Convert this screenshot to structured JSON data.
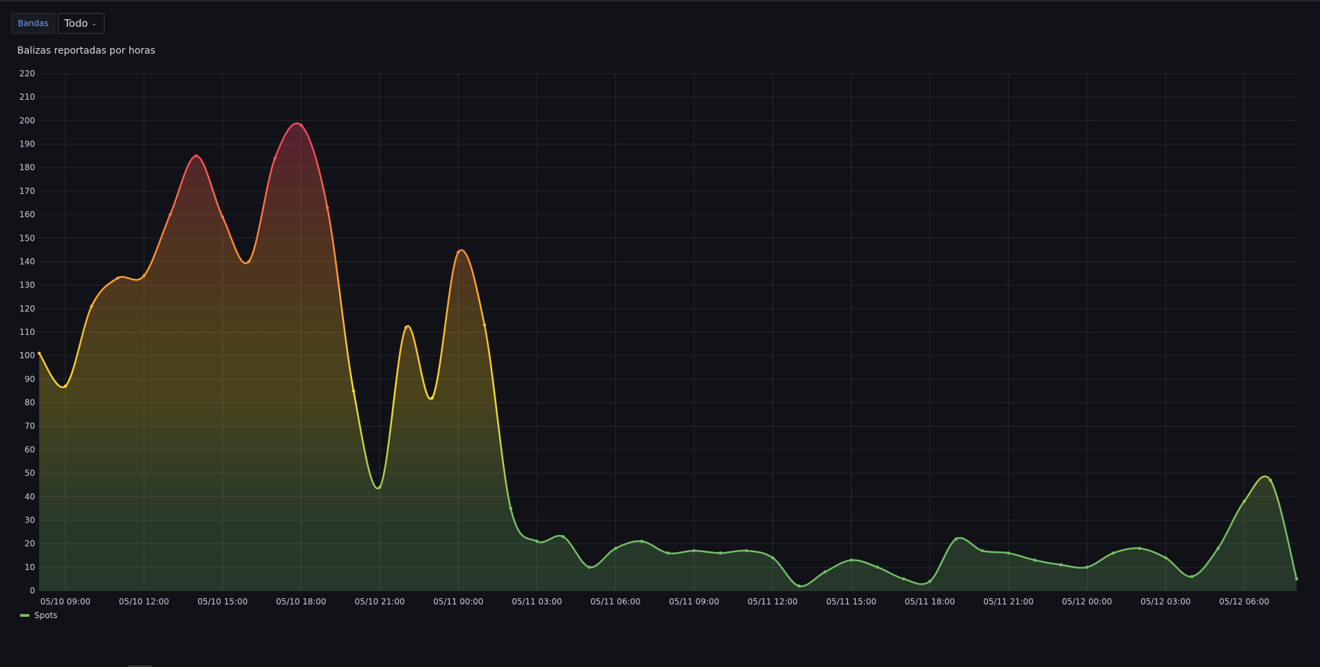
{
  "toolbar": {
    "variable_label": "Bandas",
    "variable_value": "Todo"
  },
  "panel": {
    "title": "Balizas reportadas por horas"
  },
  "colors": {
    "background": "#111217",
    "grid": "#272a31",
    "axis_text": "#ccccdc",
    "series_low": "#73bf69",
    "series_mid": "#fade2a",
    "series_mid_high": "#ff9830",
    "series_high": "#f2495c"
  },
  "legend": {
    "series_name": "Spots",
    "color": "#73bf69"
  },
  "chart_data": {
    "type": "area",
    "title": "Balizas reportadas por horas",
    "xlabel": "",
    "ylabel": "",
    "ylim": [
      0,
      220
    ],
    "ytick_step": 10,
    "x_start": "05/10 08:00",
    "x_step_hours": 1,
    "x_ticks": [
      "05/10 09:00",
      "05/10 12:00",
      "05/10 15:00",
      "05/10 18:00",
      "05/10 21:00",
      "05/11 00:00",
      "05/11 03:00",
      "05/11 06:00",
      "05/11 09:00",
      "05/11 12:00",
      "05/11 15:00",
      "05/11 18:00",
      "05/11 21:00",
      "05/12 00:00",
      "05/12 03:00",
      "05/12 06:00"
    ],
    "grid": true,
    "legend_position": "bottom-left",
    "color_scheme": "green-yellow-red by value",
    "series": [
      {
        "name": "Spots",
        "values": [
          101,
          87,
          121,
          133,
          134,
          160,
          185,
          159,
          140,
          184,
          198,
          163,
          85,
          44,
          112,
          82,
          144,
          113,
          35,
          21,
          23,
          10,
          18,
          21,
          16,
          17,
          16,
          17,
          14,
          2,
          8,
          13,
          10,
          5,
          4,
          22,
          17,
          16,
          13,
          11,
          10,
          16,
          18,
          14,
          6,
          18,
          38,
          47,
          5
        ]
      }
    ]
  }
}
